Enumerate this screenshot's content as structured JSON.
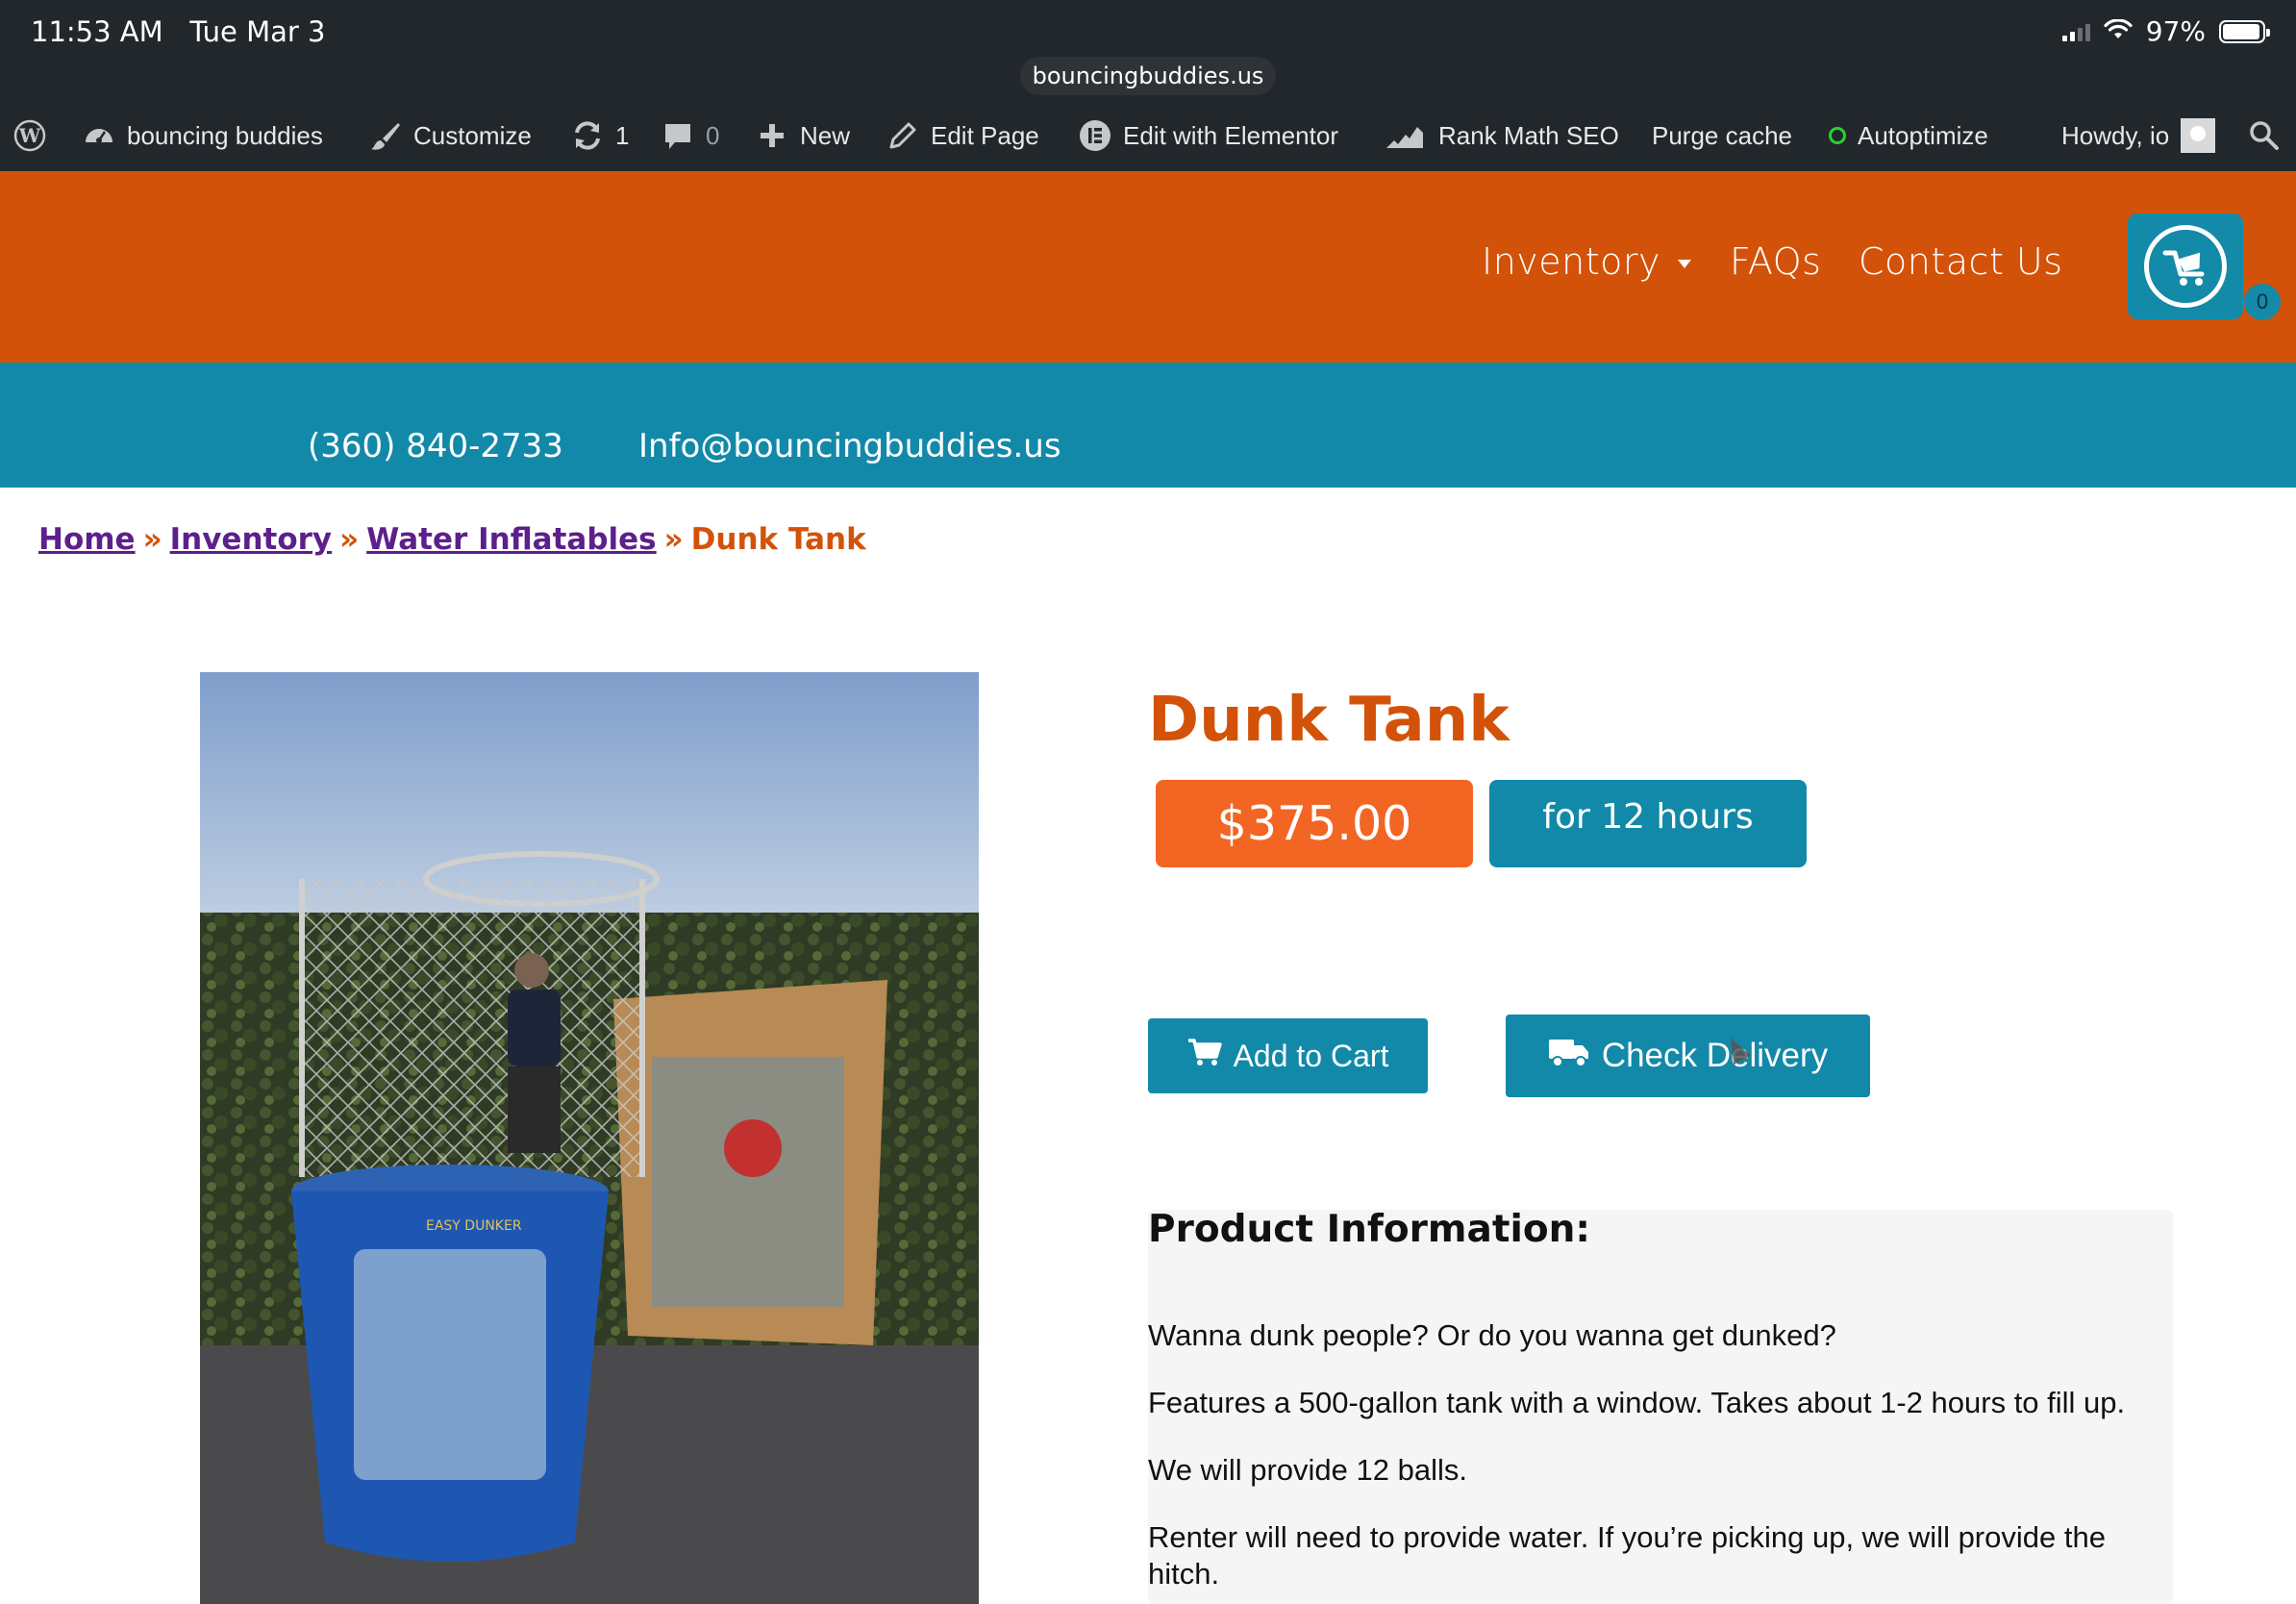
{
  "status_bar": {
    "time": "11:53 AM",
    "date": "Tue Mar 3",
    "battery": "97%",
    "url": "bouncingbuddies.us"
  },
  "admin_bar": {
    "site_name": "bouncing buddies",
    "customize": "Customize",
    "updates_count": "1",
    "comments_count": "0",
    "new": "New",
    "edit_page": "Edit Page",
    "edit_elementor": "Edit with Elementor",
    "rank_math": "Rank Math SEO",
    "purge_cache": "Purge cache",
    "autoptimize": "Autoptimize",
    "howdy": "Howdy, io"
  },
  "header": {
    "nav": [
      {
        "label": "Inventory"
      },
      {
        "label": "FAQs"
      },
      {
        "label": "Contact Us"
      }
    ],
    "cart_count": "0"
  },
  "contact_bar": {
    "phone": "(360) 840-2733",
    "email": "Info@bouncingbuddies.us"
  },
  "breadcrumb": {
    "items": [
      "Home",
      "Inventory",
      "Water Inflatables"
    ],
    "separator": "»",
    "current": "Dunk Tank"
  },
  "product": {
    "title": "Dunk Tank",
    "price": "$375.00",
    "period": "for 12 hours",
    "add_to_cart": "Add to Cart",
    "check_delivery": "Check Delivery",
    "info_heading": "Product Information:",
    "info_paragraphs": [
      "Wanna dunk people? Or do you wanna get dunked?",
      "Features a 500-gallon tank with a window. Takes about 1-2 hours to fill up.",
      "We will provide 12 balls.",
      "Renter will need to provide water. If you’re picking up, we will provide the hitch."
    ],
    "image_tank_label": "EASY DUNKER"
  },
  "colors": {
    "orange": "#d35209",
    "teal": "#1289a8",
    "price_orange": "#f26522",
    "admin_bg": "#22272c",
    "link_purple": "#5d1f8c"
  }
}
